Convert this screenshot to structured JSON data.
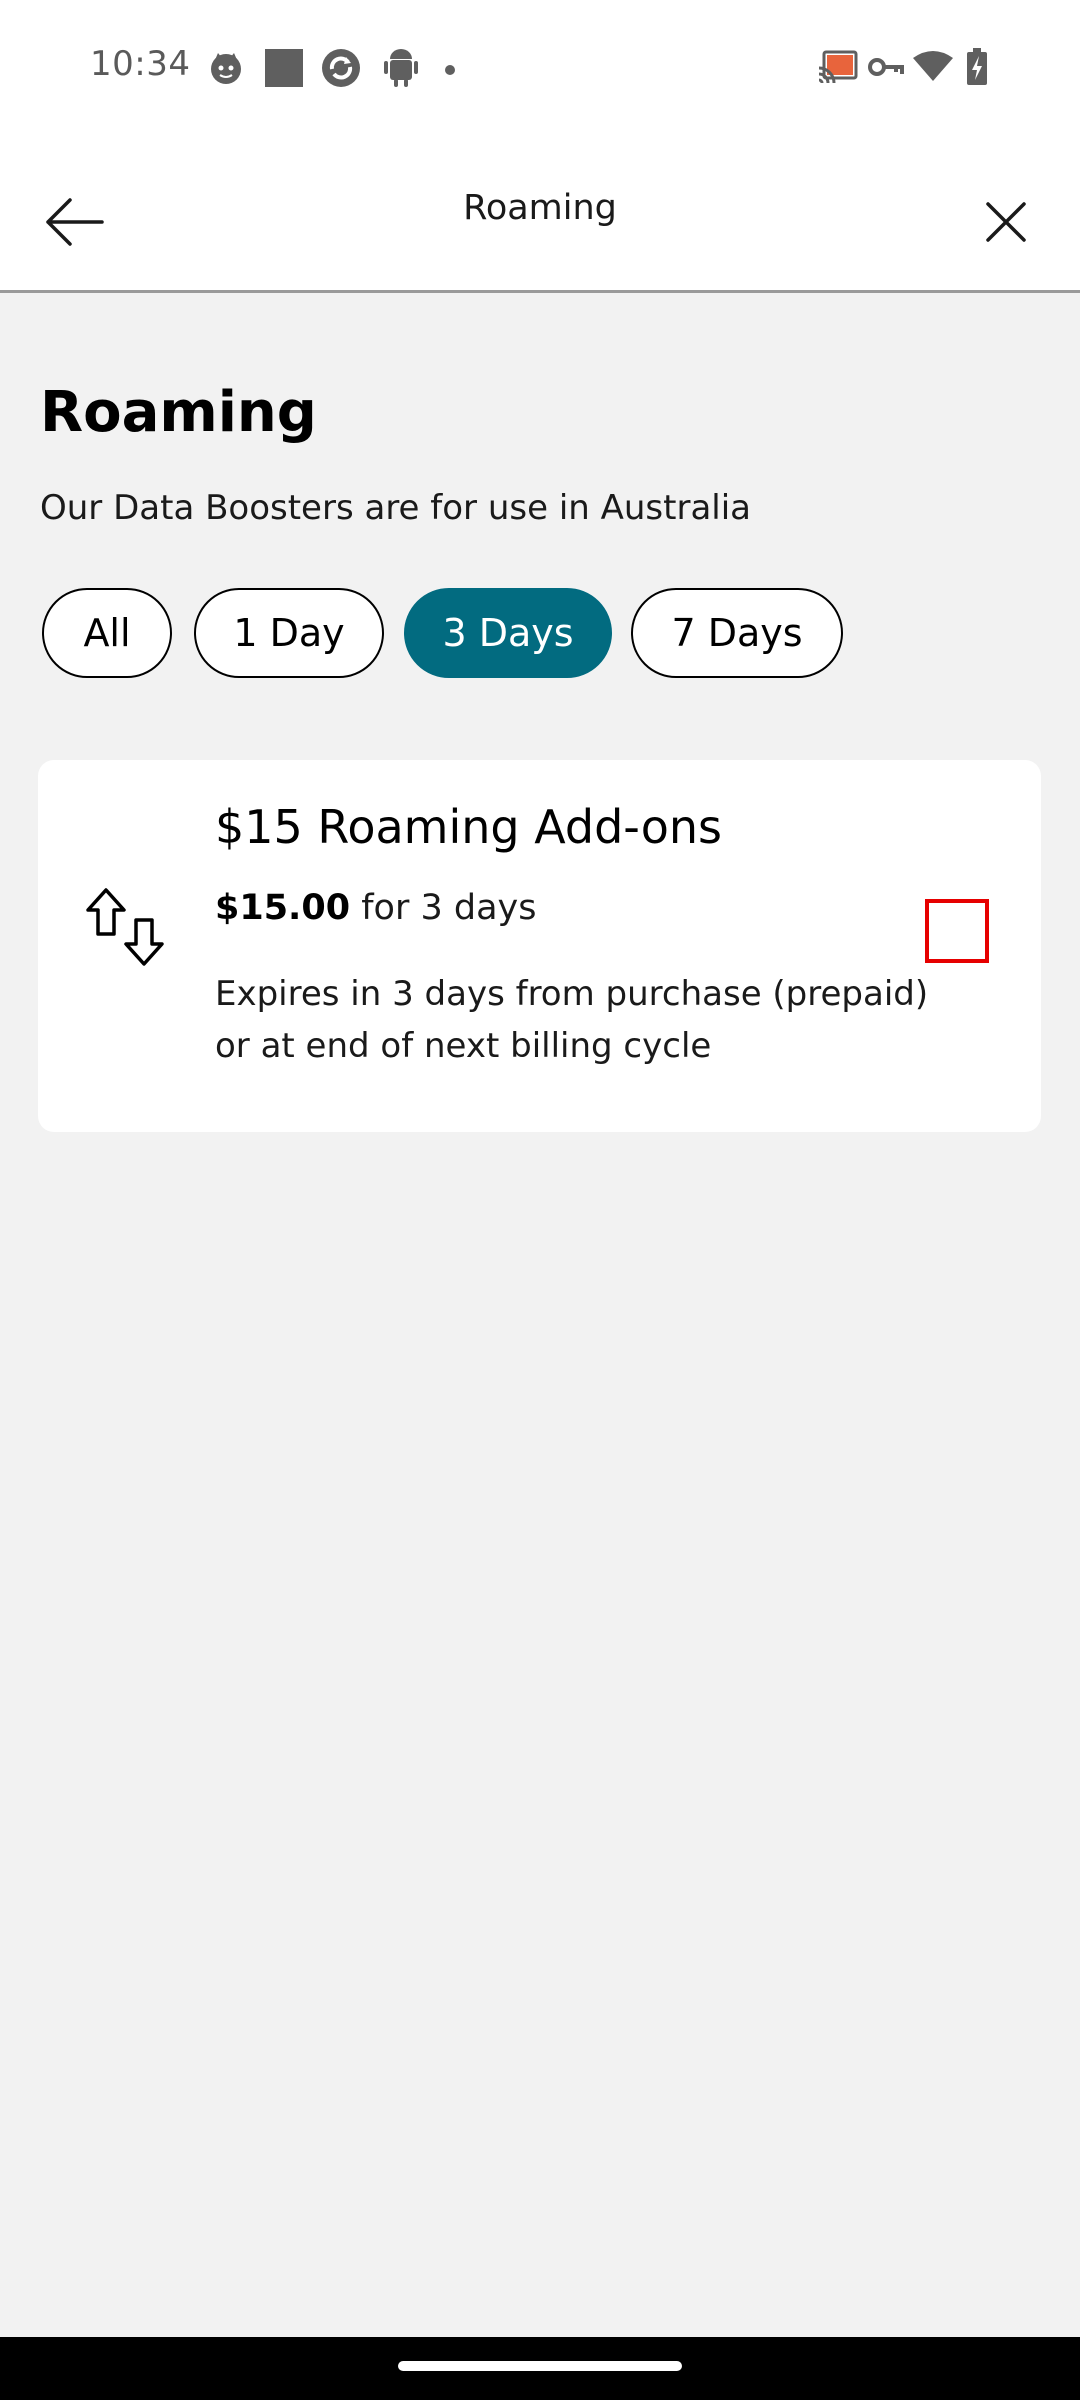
{
  "status_bar": {
    "time": "10:34",
    "left_icons": [
      "cat-face-icon",
      "square-icon",
      "sync-app-icon",
      "android-icon",
      "dot-icon"
    ],
    "right_icons": [
      "cast-icon",
      "vpn-key-icon",
      "wifi-icon",
      "battery-charging-icon"
    ],
    "cast_color": "#e8643c"
  },
  "app_bar": {
    "title": "Roaming",
    "back_icon": "arrow-left-icon",
    "close_icon": "close-icon"
  },
  "page": {
    "title": "Roaming",
    "subtitle": "Our Data Boosters are for use in Australia"
  },
  "filters": {
    "chips": [
      {
        "label": "All",
        "selected": false
      },
      {
        "label": "1 Day",
        "selected": false
      },
      {
        "label": "3 Days",
        "selected": true
      },
      {
        "label": "7 Days",
        "selected": false
      }
    ],
    "selected_color": "#026b80"
  },
  "offer": {
    "icon": "transfer-arrows-icon",
    "title": "$15 Roaming Add-ons",
    "price": "$15.00",
    "period": "for 3 days",
    "description": "Expires in 3 days from purchase (prepaid) or at end of next billing cycle",
    "checked": false,
    "checkbox_color": "#e60000"
  }
}
